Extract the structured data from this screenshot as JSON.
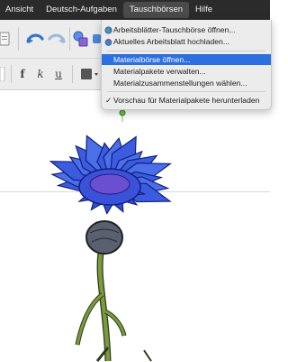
{
  "menubar": {
    "items": [
      "Ansicht",
      "Deutsch-Aufgaben",
      "Tauschbörsen",
      "Hilfe"
    ],
    "active_index": 2
  },
  "dropdown": {
    "items": [
      {
        "label": "Arbeitsblätter-Tauschbörse öffnen...",
        "icon": "globe-icon"
      },
      {
        "label": "Aktuelles Arbeitsblatt hochladen...",
        "icon": "globe-upload-icon"
      },
      {
        "label": "Materialbörse öffnen...",
        "highlighted": true
      },
      {
        "label": "Materialpakete verwalten..."
      },
      {
        "label": "Materialzusammenstellungen wählen..."
      },
      {
        "label": "Vorschau für Materialpakete herunterladen",
        "checked": true
      }
    ]
  },
  "toolbar": {
    "format_bold_glyph": "f",
    "format_italic_glyph": "k",
    "format_underline_glyph": "u"
  },
  "colors": {
    "menubar_bg": "#2b2b2b",
    "highlight": "#2e6fe0",
    "flower_blue": "#4a6fe8",
    "stem_green": "#7a9a3c"
  }
}
